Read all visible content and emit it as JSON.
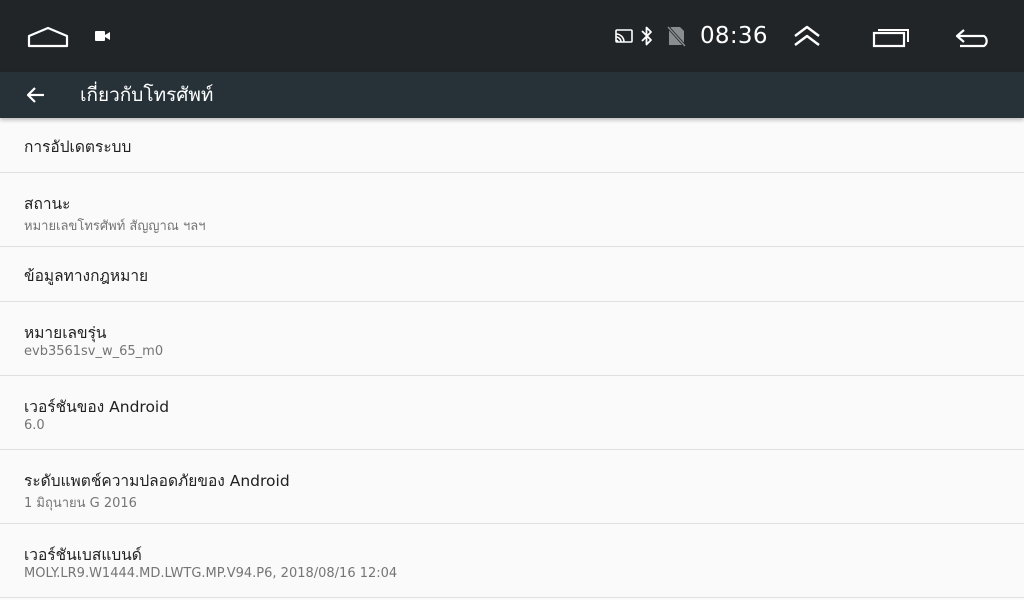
{
  "status_bar": {
    "clock": "08:36",
    "icons": [
      "home-icon",
      "screen-recorder-icon",
      "cast-icon",
      "bluetooth-icon",
      "no-sim-icon",
      "expand-up-icon",
      "recent-apps-icon",
      "back-icon"
    ]
  },
  "app_bar": {
    "title": "เกี่ยวกับโทรศัพท์",
    "back_icon": "arrow-left-icon",
    "background": "#263238"
  },
  "items": [
    {
      "title": "การอัปเดตระบบ",
      "subtitle": ""
    },
    {
      "title": "สถานะ",
      "subtitle": "หมายเลขโทรศัพท์ สัญญาณ ฯลฯ"
    },
    {
      "title": "ข้อมูลทางกฎหมาย",
      "subtitle": ""
    },
    {
      "title": "หมายเลขรุ่น",
      "subtitle": "evb3561sv_w_65_m0"
    },
    {
      "title": "เวอร์ชันของ Android",
      "subtitle": "6.0"
    },
    {
      "title": "ระดับแพตช์ความปลอดภัยของ Android",
      "subtitle": "1 มิถุนายน G 2016"
    },
    {
      "title": "เวอร์ชันเบสแบนด์",
      "subtitle": "MOLY.LR9.W1444.MD.LWTG.MP.V94.P6, 2018/08/16 12:04"
    }
  ]
}
